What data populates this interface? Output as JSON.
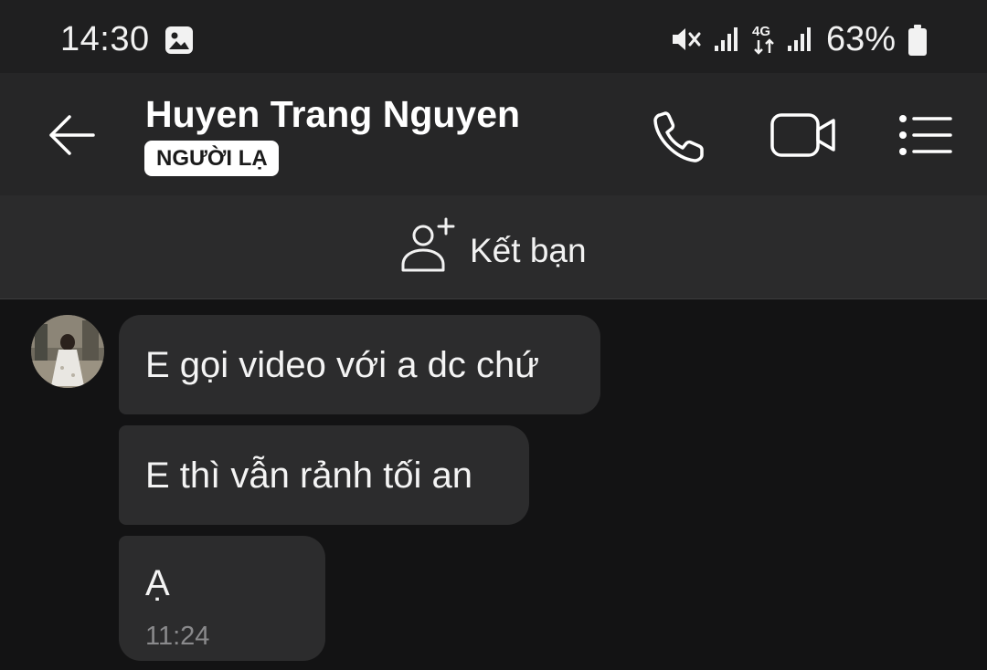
{
  "status_bar": {
    "time": "14:30",
    "battery": "63%",
    "icons": [
      "gallery-icon",
      "mute-icon",
      "signal-icon",
      "4g-icon",
      "signal-icon",
      "battery-icon"
    ]
  },
  "header": {
    "contact_name": "Huyen Trang Nguyen",
    "badge": "NGƯỜI LẠ",
    "icons": [
      "back-arrow-icon",
      "phone-icon",
      "video-camera-icon",
      "list-menu-icon"
    ]
  },
  "add_friend": {
    "label": "Kết bạn",
    "icon": "add-person-icon"
  },
  "messages": [
    {
      "text": "E gọi video với a dc chứ"
    },
    {
      "text": "E thì vẫn rảnh tối an"
    },
    {
      "text": "Ạ",
      "time": "11:24"
    }
  ],
  "colors": {
    "background": "#131314",
    "status_bar": "#1f1f20",
    "header": "#262627",
    "add_friend_bar": "#2b2b2c",
    "bubble": "#2c2c2d",
    "time_text": "#8a8a8c"
  }
}
